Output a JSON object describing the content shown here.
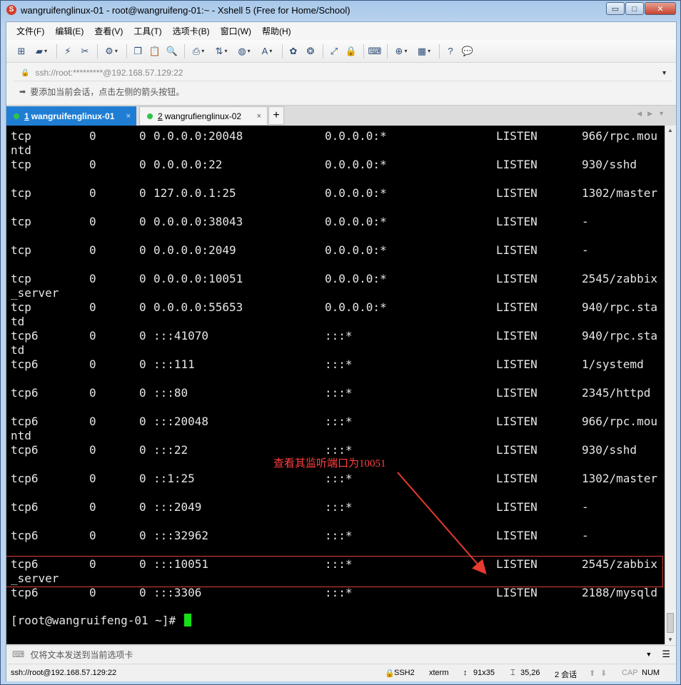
{
  "window": {
    "title": "wangruifenglinux-01 - root@wangruifeng-01:~ - Xshell 5 (Free for Home/School)",
    "controls": {
      "minimize": "▭",
      "maximize": "□",
      "close": "✕"
    }
  },
  "menu": [
    "文件(F)",
    "编辑(E)",
    "查看(V)",
    "工具(T)",
    "选项卡(B)",
    "窗口(W)",
    "帮助(H)"
  ],
  "address": "ssh://root:*********@192.168.57.129:22",
  "hint": "要添加当前会话，点击左侧的箭头按钮。",
  "tabs": [
    {
      "num": "1",
      "label": "wangruifenglinux-01",
      "close": "×"
    },
    {
      "num": "2",
      "label": "wangrufienglinux-02",
      "close": "×"
    }
  ],
  "tab_add": "+",
  "terminal": {
    "rows": [
      {
        "proto": "tcp",
        "recv": "0",
        "send": "0",
        "local": "0.0.0.0:20048",
        "foreign": "0.0.0.0:*",
        "state": "LISTEN",
        "pid": "966/rpc.mou",
        "wrap": "ntd"
      },
      {
        "proto": "tcp",
        "recv": "0",
        "send": "0",
        "local": "0.0.0.0:22",
        "foreign": "0.0.0.0:*",
        "state": "LISTEN",
        "pid": "930/sshd",
        "wrap": ""
      },
      {
        "proto": "tcp",
        "recv": "0",
        "send": "0",
        "local": "127.0.0.1:25",
        "foreign": "0.0.0.0:*",
        "state": "LISTEN",
        "pid": "1302/master",
        "wrap": ""
      },
      {
        "proto": "tcp",
        "recv": "0",
        "send": "0",
        "local": "0.0.0.0:38043",
        "foreign": "0.0.0.0:*",
        "state": "LISTEN",
        "pid": "-",
        "wrap": ""
      },
      {
        "proto": "tcp",
        "recv": "0",
        "send": "0",
        "local": "0.0.0.0:2049",
        "foreign": "0.0.0.0:*",
        "state": "LISTEN",
        "pid": "-",
        "wrap": ""
      },
      {
        "proto": "tcp",
        "recv": "0",
        "send": "0",
        "local": "0.0.0.0:10051",
        "foreign": "0.0.0.0:*",
        "state": "LISTEN",
        "pid": "2545/zabbix",
        "wrap": "_server"
      },
      {
        "proto": "tcp",
        "recv": "0",
        "send": "0",
        "local": "0.0.0.0:55653",
        "foreign": "0.0.0.0:*",
        "state": "LISTEN",
        "pid": "940/rpc.sta",
        "wrap": "td"
      },
      {
        "proto": "tcp6",
        "recv": "0",
        "send": "0",
        "local": ":::41070",
        "foreign": ":::*",
        "state": "LISTEN",
        "pid": "940/rpc.sta",
        "wrap": "td"
      },
      {
        "proto": "tcp6",
        "recv": "0",
        "send": "0",
        "local": ":::111",
        "foreign": ":::*",
        "state": "LISTEN",
        "pid": "1/systemd",
        "wrap": ""
      },
      {
        "proto": "tcp6",
        "recv": "0",
        "send": "0",
        "local": ":::80",
        "foreign": ":::*",
        "state": "LISTEN",
        "pid": "2345/httpd",
        "wrap": ""
      },
      {
        "proto": "tcp6",
        "recv": "0",
        "send": "0",
        "local": ":::20048",
        "foreign": ":::*",
        "state": "LISTEN",
        "pid": "966/rpc.mou",
        "wrap": "ntd"
      },
      {
        "proto": "tcp6",
        "recv": "0",
        "send": "0",
        "local": ":::22",
        "foreign": ":::*",
        "state": "LISTEN",
        "pid": "930/sshd",
        "wrap": ""
      },
      {
        "proto": "tcp6",
        "recv": "0",
        "send": "0",
        "local": "::1:25",
        "foreign": ":::*",
        "state": "LISTEN",
        "pid": "1302/master",
        "wrap": ""
      },
      {
        "proto": "tcp6",
        "recv": "0",
        "send": "0",
        "local": ":::2049",
        "foreign": ":::*",
        "state": "LISTEN",
        "pid": "-",
        "wrap": ""
      },
      {
        "proto": "tcp6",
        "recv": "0",
        "send": "0",
        "local": ":::32962",
        "foreign": ":::*",
        "state": "LISTEN",
        "pid": "-",
        "wrap": ""
      },
      {
        "proto": "tcp6",
        "recv": "0",
        "send": "0",
        "local": ":::10051",
        "foreign": ":::*",
        "state": "LISTEN",
        "pid": "2545/zabbix",
        "wrap": "_server"
      },
      {
        "proto": "tcp6",
        "recv": "0",
        "send": "0",
        "local": ":::3306",
        "foreign": ":::*",
        "state": "LISTEN",
        "pid": "2188/mysqld",
        "wrap": ""
      }
    ],
    "prompt": "[root@wangruifeng-01 ~]# "
  },
  "annotation": {
    "text": "查看其监听端口为10051",
    "color": "#ff4040"
  },
  "sendbar": {
    "text": "仅将文本发送到当前选项卡"
  },
  "status": {
    "connection": "ssh://root@192.168.57.129:22",
    "protocol": "SSH2",
    "terminal": "xterm",
    "size": "91x35",
    "cursor": "35,26",
    "sessions": "2 会话",
    "caps": "CAP",
    "num": "NUM"
  },
  "colors": {
    "tab_active": "#1f7ed4",
    "cursor": "#16e016",
    "highlight": "#e0403a"
  }
}
